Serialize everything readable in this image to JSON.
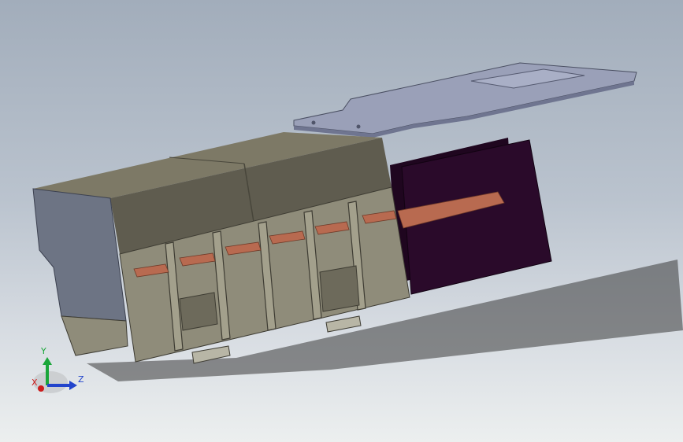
{
  "viewport": {
    "background_top": "#a2adbb",
    "background_bottom": "#ecefef"
  },
  "model": {
    "body_color": "#6e6b5e",
    "plate_color": "#9aa0b8",
    "board_color": "#2a0a2a",
    "pin_color": "#b86a50",
    "endcap_color": "#6d7484"
  },
  "triad": {
    "y_label": "Y",
    "z_label": "Z",
    "x_label": "X",
    "y_color": "#1aa63a",
    "z_color": "#2244cc",
    "x_color": "#cc1d1d"
  }
}
